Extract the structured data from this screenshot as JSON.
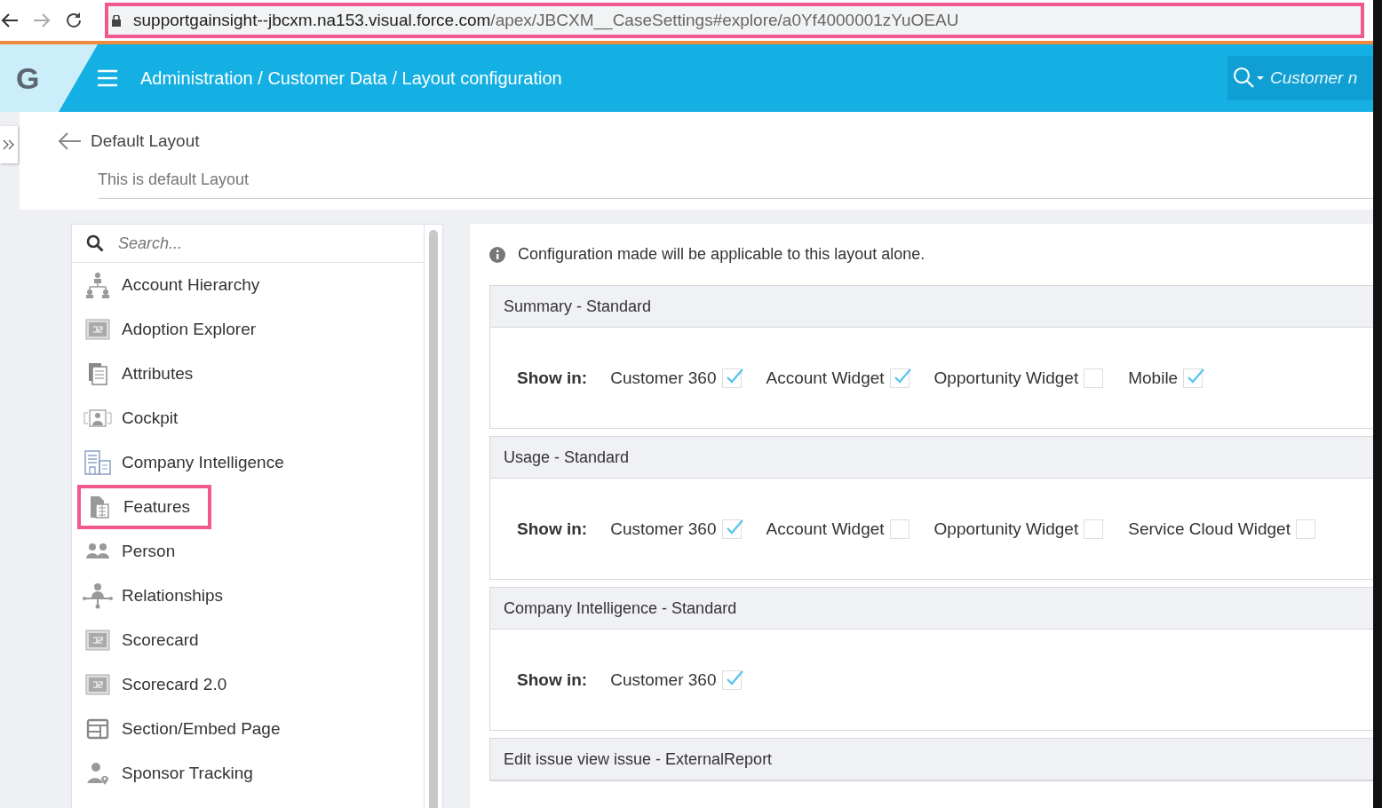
{
  "browser": {
    "url_host": "supportgainsight--jbcxm.na153.visual.force.com",
    "url_path": "/apex/JBCXM__CaseSettings#explore/a0Yf4000001zYuOEAU",
    "url_highlighted": true
  },
  "header": {
    "logo": "G",
    "breadcrumb": "Administration / Customer Data / Layout configuration",
    "search_placeholder": "Customer n"
  },
  "layout": {
    "title": "Default Layout",
    "description": "This is default Layout"
  },
  "sidebar": {
    "search_placeholder": "Search...",
    "items": [
      {
        "label": "Account Hierarchy",
        "kind": "hierarchy",
        "highlighted": false
      },
      {
        "label": "Adoption Explorer",
        "kind": "score",
        "highlighted": false
      },
      {
        "label": "Attributes",
        "kind": "document",
        "highlighted": false
      },
      {
        "label": "Cockpit",
        "kind": "cockpit",
        "highlighted": false
      },
      {
        "label": "Company Intelligence",
        "kind": "building",
        "highlighted": false
      },
      {
        "label": "Features",
        "kind": "features",
        "highlighted": true
      },
      {
        "label": "Person",
        "kind": "people",
        "highlighted": false
      },
      {
        "label": "Relationships",
        "kind": "relation",
        "highlighted": false
      },
      {
        "label": "Scorecard",
        "kind": "score",
        "highlighted": false
      },
      {
        "label": "Scorecard 2.0",
        "kind": "score",
        "highlighted": false
      },
      {
        "label": "Section/Embed Page",
        "kind": "section",
        "highlighted": false
      },
      {
        "label": "Sponsor Tracking",
        "kind": "sponsor",
        "highlighted": false
      }
    ]
  },
  "info": "Configuration made will be applicable to this layout alone.",
  "sections": [
    {
      "title": "Summary - Standard",
      "show_in_label": "Show in:",
      "options": [
        {
          "label": "Customer 360",
          "checked": true
        },
        {
          "label": "Account Widget",
          "checked": true
        },
        {
          "label": "Opportunity Widget",
          "checked": false
        },
        {
          "label": "Mobile",
          "checked": true
        }
      ]
    },
    {
      "title": "Usage - Standard",
      "show_in_label": "Show in:",
      "options": [
        {
          "label": "Customer 360",
          "checked": true
        },
        {
          "label": "Account Widget",
          "checked": false
        },
        {
          "label": "Opportunity Widget",
          "checked": false
        },
        {
          "label": "Service Cloud Widget",
          "checked": false
        }
      ]
    },
    {
      "title": "Company Intelligence - Standard",
      "show_in_label": "Show in:",
      "options": [
        {
          "label": "Customer 360",
          "checked": true
        }
      ]
    },
    {
      "title": "Edit issue view issue - ExternalReport"
    }
  ]
}
